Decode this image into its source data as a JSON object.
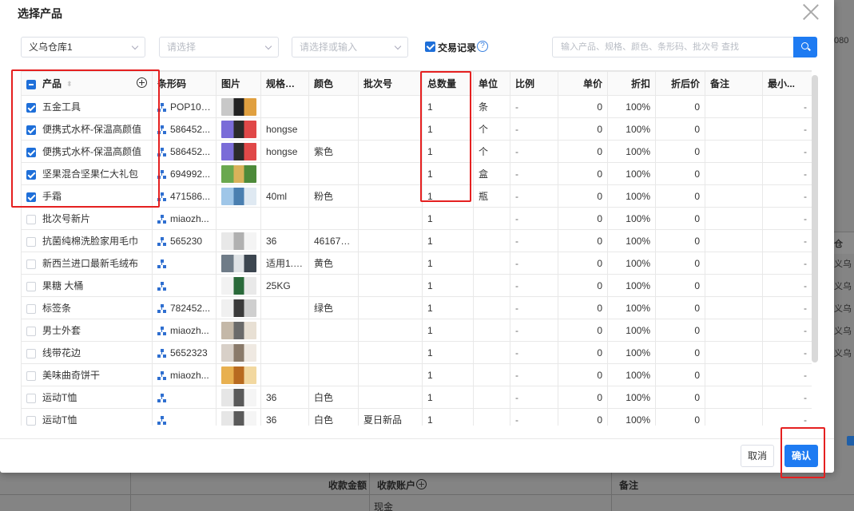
{
  "modal": {
    "title": "选择产品"
  },
  "filters": {
    "warehouse": "义乌仓库1",
    "select2_placeholder": "请选择",
    "select3_placeholder": "请选择或输入",
    "trade_record_label": "交易记录",
    "help_glyph": "?",
    "search_placeholder": "输入产品、规格、颜色、条形码、批次号 查找"
  },
  "table": {
    "headers": {
      "product": "产品",
      "sort_glyph": "⬍",
      "barcode": "条形码",
      "image": "图片",
      "spec": "规格型号",
      "color": "颜色",
      "batch": "批次号",
      "qty": "总数量",
      "unit": "单位",
      "ratio": "比例",
      "price": "单价",
      "discount": "折扣",
      "discounted_price": "折后价",
      "note": "备注",
      "min": "最小..."
    },
    "rows": [
      {
        "checked": true,
        "product": "五金工具",
        "barcode": "POP100...",
        "img": [
          "#c8c8c8",
          "#222",
          "#e0a040"
        ],
        "spec": "",
        "color": "",
        "batch": "",
        "qty": "1",
        "unit": "条",
        "ratio": "-",
        "price": "0",
        "discount": "100%",
        "dprice": "0",
        "note": "",
        "min": "-"
      },
      {
        "checked": true,
        "product": "便携式水杯-保温高颜值",
        "barcode": "586452...",
        "img": [
          "#7a6cd8",
          "#2b2b2b",
          "#e04848"
        ],
        "spec": "hongse",
        "color": "",
        "batch": "",
        "qty": "1",
        "unit": "个",
        "ratio": "-",
        "price": "0",
        "discount": "100%",
        "dprice": "0",
        "note": "",
        "min": "-"
      },
      {
        "checked": true,
        "product": "便携式水杯-保温高颜值",
        "barcode": "586452...",
        "img": [
          "#7a6cd8",
          "#2b2b2b",
          "#e04848"
        ],
        "spec": "hongse",
        "color": "紫色",
        "batch": "",
        "qty": "1",
        "unit": "个",
        "ratio": "-",
        "price": "0",
        "discount": "100%",
        "dprice": "0",
        "note": "",
        "min": "-"
      },
      {
        "checked": true,
        "product": "坚果混合坚果仁大礼包",
        "barcode": "694992...",
        "img": [
          "#6aa84f",
          "#d9b25a",
          "#4d8a3a"
        ],
        "spec": "",
        "color": "",
        "batch": "",
        "qty": "1",
        "unit": "盒",
        "ratio": "-",
        "price": "0",
        "discount": "100%",
        "dprice": "0",
        "note": "",
        "min": "-"
      },
      {
        "checked": true,
        "product": "手霜",
        "barcode": "471586...",
        "img": [
          "#9fc6e8",
          "#4a7fb0",
          "#dfe9f2"
        ],
        "spec": "40ml",
        "color": "粉色",
        "batch": "",
        "qty": "1",
        "unit": "瓶",
        "ratio": "-",
        "price": "0",
        "discount": "100%",
        "dprice": "0",
        "note": "",
        "min": "-"
      },
      {
        "checked": false,
        "product": "批次号新片",
        "barcode": "miaozh...",
        "img": null,
        "spec": "",
        "color": "",
        "batch": "",
        "qty": "1",
        "unit": "",
        "ratio": "-",
        "price": "0",
        "discount": "100%",
        "dprice": "0",
        "note": "",
        "min": "-"
      },
      {
        "checked": false,
        "product": "抗菌纯棉洗脸家用毛巾",
        "barcode": "565230",
        "img": [
          "#e8e8e8",
          "#b0b0b0",
          "#f4f4f4"
        ],
        "spec": "36",
        "color": "461672...",
        "batch": "",
        "qty": "1",
        "unit": "",
        "ratio": "-",
        "price": "0",
        "discount": "100%",
        "dprice": "0",
        "note": "",
        "min": "-"
      },
      {
        "checked": false,
        "product": "新西兰进口最新毛绒布",
        "barcode": "",
        "img": [
          "#6f7c88",
          "#dfe3e6",
          "#3c4650"
        ],
        "spec": "适用1.5...",
        "color": "黄色",
        "batch": "",
        "qty": "1",
        "unit": "",
        "ratio": "-",
        "price": "0",
        "discount": "100%",
        "dprice": "0",
        "note": "",
        "min": "-"
      },
      {
        "checked": false,
        "product": "果糖 大桶",
        "barcode": "",
        "img": [
          "#f2f2f2",
          "#2a6a3a",
          "#e9e9e9"
        ],
        "spec": "25KG",
        "color": "",
        "batch": "",
        "qty": "1",
        "unit": "",
        "ratio": "-",
        "price": "0",
        "discount": "100%",
        "dprice": "0",
        "note": "",
        "min": "-"
      },
      {
        "checked": false,
        "product": "标签条",
        "barcode": "782452...",
        "img": [
          "#f0f0f0",
          "#3a3a3a",
          "#cfcfcf"
        ],
        "spec": "",
        "color": "绿色",
        "batch": "",
        "qty": "1",
        "unit": "",
        "ratio": "-",
        "price": "0",
        "discount": "100%",
        "dprice": "0",
        "note": "",
        "min": "-"
      },
      {
        "checked": false,
        "product": "男士外套",
        "barcode": "miaozh...",
        "img": [
          "#c4b8a8",
          "#6a6a6a",
          "#e8e0d4"
        ],
        "spec": "",
        "color": "",
        "batch": "",
        "qty": "1",
        "unit": "",
        "ratio": "-",
        "price": "0",
        "discount": "100%",
        "dprice": "0",
        "note": "",
        "min": "-"
      },
      {
        "checked": false,
        "product": "线带花边",
        "barcode": "5652323",
        "img": [
          "#d8d0c8",
          "#8a7a6a",
          "#efe9e2"
        ],
        "spec": "",
        "color": "",
        "batch": "",
        "qty": "1",
        "unit": "",
        "ratio": "-",
        "price": "0",
        "discount": "100%",
        "dprice": "0",
        "note": "",
        "min": "-"
      },
      {
        "checked": false,
        "product": "美味曲奇饼干",
        "barcode": "miaozh...",
        "img": [
          "#e8b050",
          "#b86a20",
          "#f2d8a0"
        ],
        "spec": "",
        "color": "",
        "batch": "",
        "qty": "1",
        "unit": "",
        "ratio": "-",
        "price": "0",
        "discount": "100%",
        "dprice": "0",
        "note": "",
        "min": "-"
      },
      {
        "checked": false,
        "product": "运动T恤",
        "barcode": "",
        "img": [
          "#e6e6e6",
          "#5a5a5a",
          "#f5f5f5"
        ],
        "spec": "36",
        "color": "白色",
        "batch": "",
        "qty": "1",
        "unit": "",
        "ratio": "-",
        "price": "0",
        "discount": "100%",
        "dprice": "0",
        "note": "",
        "min": "-"
      },
      {
        "checked": false,
        "product": "运动T恤",
        "barcode": "",
        "img": [
          "#e6e6e6",
          "#5a5a5a",
          "#f5f5f5"
        ],
        "spec": "36",
        "color": "白色",
        "batch": "夏日新品",
        "qty": "1",
        "unit": "",
        "ratio": "-",
        "price": "0",
        "discount": "100%",
        "dprice": "0",
        "note": "",
        "min": "-"
      }
    ]
  },
  "footer": {
    "cancel": "取消",
    "confirm": "确认"
  },
  "background": {
    "right_top": "080",
    "right_header": "仓",
    "right_cells": [
      "义乌",
      "义乌",
      "义乌",
      "义乌",
      "义乌"
    ],
    "bottom_amount": "收款金额",
    "bottom_account": "收款账户",
    "bottom_note": "备注",
    "bottom_cash": "现金"
  },
  "colors": {
    "primary": "#1e7bf2",
    "annotation_red": "#e52020"
  }
}
